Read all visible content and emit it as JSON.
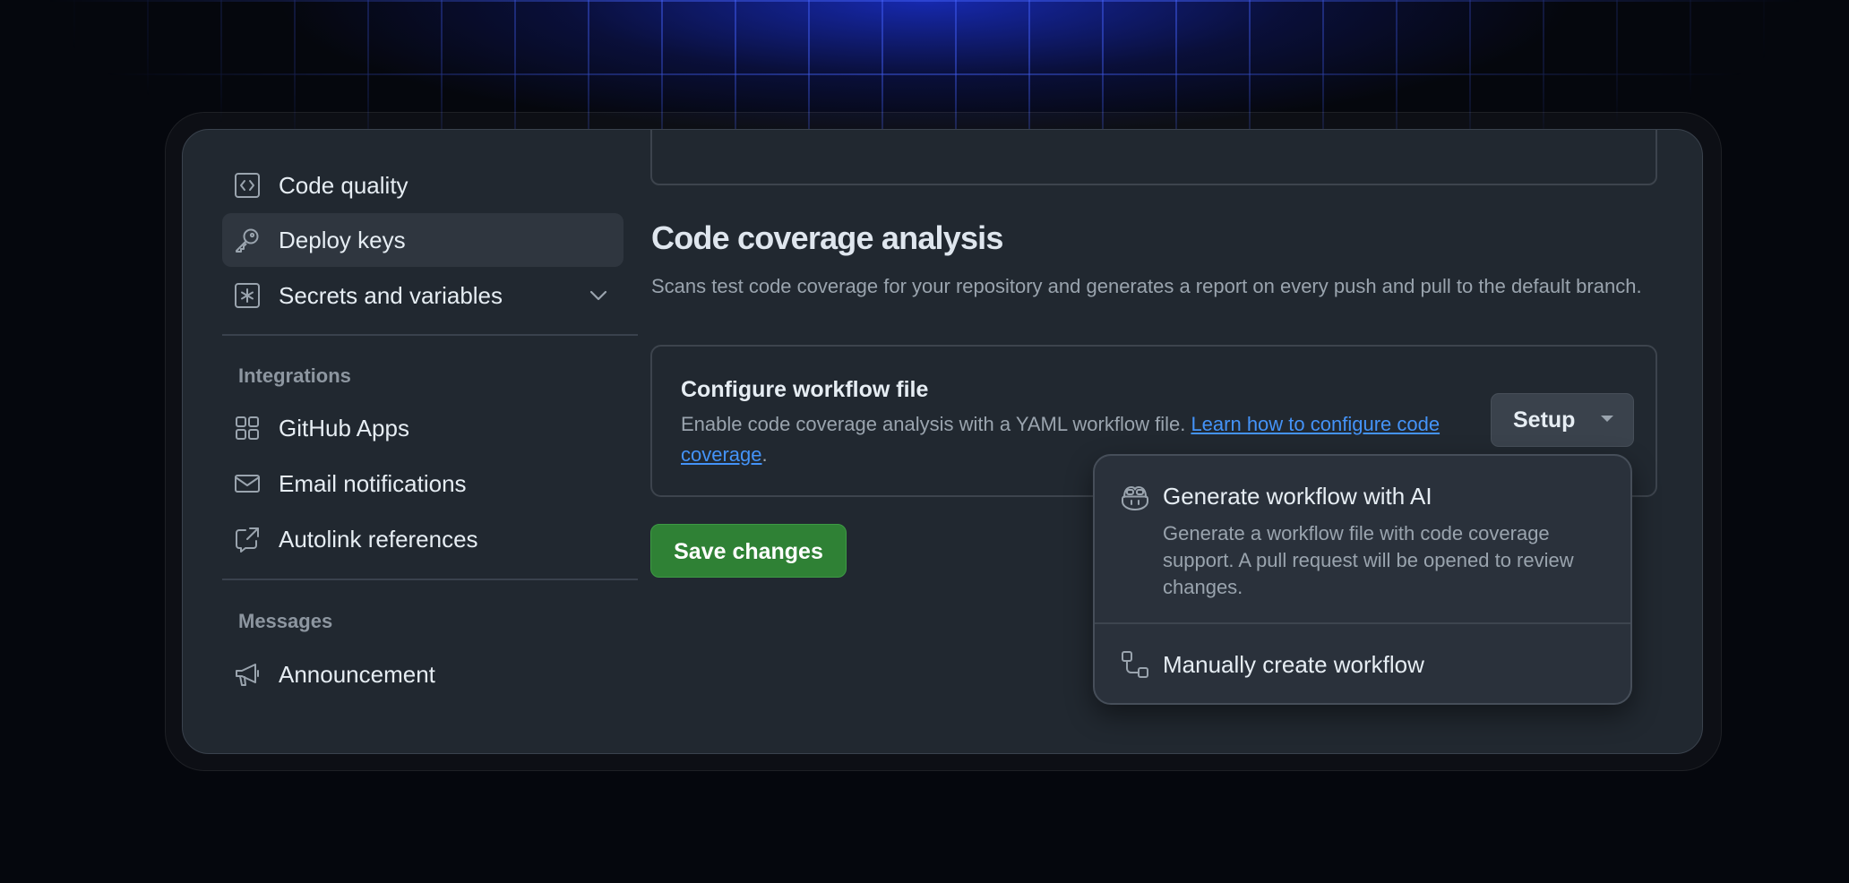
{
  "sidebar": {
    "items": [
      {
        "label": "Code quality",
        "icon": "code-square-icon"
      },
      {
        "label": "Deploy keys",
        "icon": "key-icon",
        "selected": true
      },
      {
        "label": "Secrets and variables",
        "icon": "asterisk-square-icon",
        "expandable": true
      }
    ],
    "integrations": {
      "heading": "Integrations",
      "items": [
        {
          "label": "GitHub Apps",
          "icon": "apps-icon"
        },
        {
          "label": "Email notifications",
          "icon": "mail-icon"
        },
        {
          "label": "Autolink references",
          "icon": "external-link-icon"
        }
      ]
    },
    "messages": {
      "heading": "Messages",
      "items": [
        {
          "label": "Announcement",
          "icon": "megaphone-icon"
        }
      ]
    }
  },
  "main": {
    "section_title": "Code coverage analysis",
    "section_description": "Scans test code coverage for your repository and generates a report on every push and pull to the default branch.",
    "workflow": {
      "title": "Configure workflow file",
      "description_prefix": "Enable code coverage analysis with a YAML workflow file. ",
      "link_text": "Learn how to configure code coverage",
      "description_suffix": ".",
      "setup_label": "Setup"
    },
    "save_label": "Save changes"
  },
  "dropdown": {
    "items": [
      {
        "title": "Generate workflow with AI",
        "description": "Generate a workflow file with code coverage support. A pull request will be opened to review changes.",
        "icon": "copilot-icon"
      },
      {
        "title": "Manually create workflow",
        "icon": "workflow-icon"
      }
    ]
  },
  "colors": {
    "card_background": "#212830",
    "selected_item": "#2f363f",
    "link": "#4493f8",
    "save_button": "#2f8135",
    "muted_text": "#9aa4ae"
  }
}
